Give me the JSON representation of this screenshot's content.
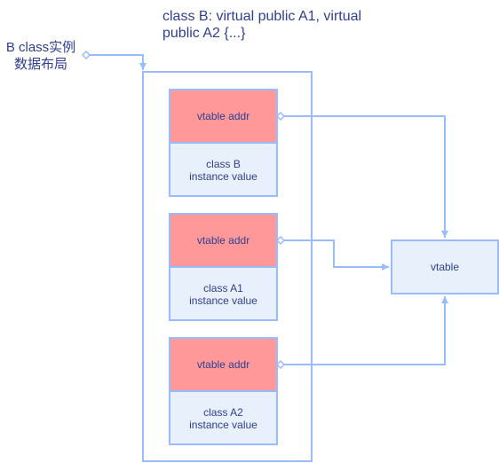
{
  "title": {
    "line1": "class B: virtual public A1, virtual",
    "line2": "public A2 {...}"
  },
  "instance_label": {
    "line1": "B class实例",
    "line2": "数据布局"
  },
  "blocks": [
    {
      "vptr": "vtable addr",
      "body_line1": "class B",
      "body_line2": "instance value"
    },
    {
      "vptr": "vtable addr",
      "body_line1": "class A1",
      "body_line2": "instance value"
    },
    {
      "vptr": "vtable addr",
      "body_line1": "class A2",
      "body_line2": "instance value"
    }
  ],
  "vtable": {
    "label": "vtable"
  },
  "colors": {
    "line": "#99bbff",
    "box_fill": "#e8f0fc",
    "vptr_fill": "#ff9999",
    "text": "#2f3f8f"
  }
}
